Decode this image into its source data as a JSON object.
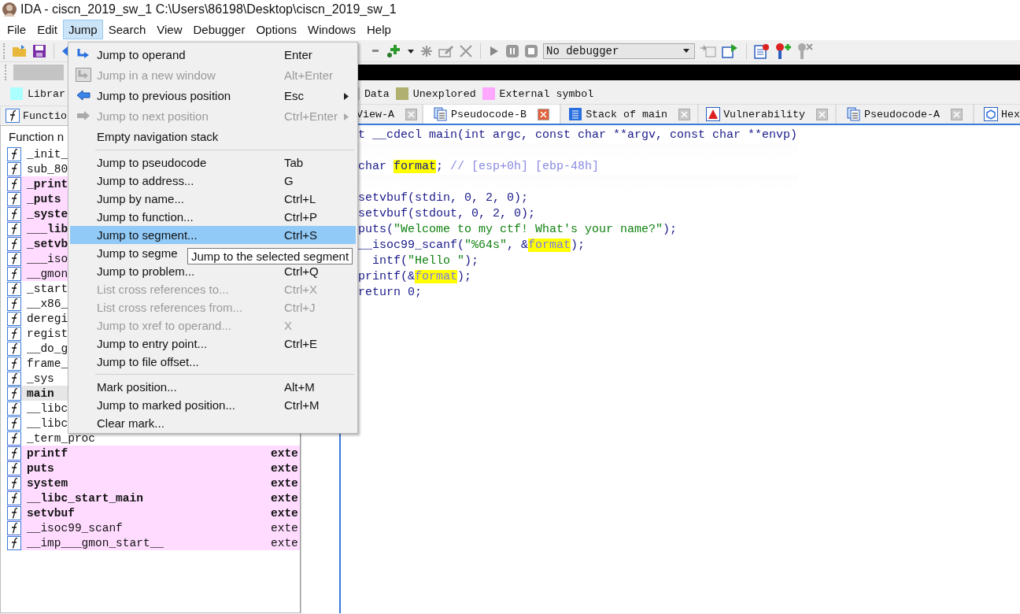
{
  "window": {
    "title": "IDA - ciscn_2019_sw_1 C:\\Users\\86198\\Desktop\\ciscn_2019_sw_1"
  },
  "menubar": [
    {
      "label": "File",
      "selected": false
    },
    {
      "label": "Edit",
      "selected": false
    },
    {
      "label": "Jump",
      "selected": true
    },
    {
      "label": "Search",
      "selected": false
    },
    {
      "label": "View",
      "selected": false
    },
    {
      "label": "Debugger",
      "selected": false
    },
    {
      "label": "Options",
      "selected": false
    },
    {
      "label": "Windows",
      "selected": false
    },
    {
      "label": "Help",
      "selected": false
    }
  ],
  "toolbar": {
    "debugger_select": "No debugger"
  },
  "legend": [
    {
      "label": "Librar",
      "color": "#aaffff"
    },
    {
      "label": "Data",
      "color": "#c0c0c0"
    },
    {
      "label": "Unexplored",
      "color": "#b0b070"
    },
    {
      "label": "External symbol",
      "color": "#ffa8ff"
    }
  ],
  "left_tab": {
    "label": "Functio"
  },
  "functions": {
    "header": "Function n",
    "rows": [
      {
        "name": "_init_",
        "kind": "regular",
        "bold": false,
        "selected": false
      },
      {
        "name": "sub_80",
        "kind": "regular",
        "bold": false,
        "selected": false
      },
      {
        "name": "_print",
        "kind": "extern",
        "bold": true,
        "selected": false
      },
      {
        "name": "_puts",
        "kind": "extern",
        "bold": true,
        "selected": false
      },
      {
        "name": "_syste",
        "kind": "extern",
        "bold": true,
        "selected": false
      },
      {
        "name": "___lib",
        "kind": "extern",
        "bold": true,
        "selected": false
      },
      {
        "name": "_setvb",
        "kind": "extern",
        "bold": true,
        "selected": false
      },
      {
        "name": "___iso",
        "kind": "extern",
        "bold": false,
        "selected": false
      },
      {
        "name": "__gmon",
        "kind": "extern",
        "bold": false,
        "selected": false
      },
      {
        "name": "_start",
        "kind": "regular",
        "bold": false,
        "selected": false
      },
      {
        "name": "__x86_",
        "kind": "regular",
        "bold": false,
        "selected": false
      },
      {
        "name": "deregi",
        "kind": "regular",
        "bold": false,
        "selected": false
      },
      {
        "name": "regist",
        "kind": "regular",
        "bold": false,
        "selected": false
      },
      {
        "name": "__do_g",
        "kind": "regular",
        "bold": false,
        "selected": false
      },
      {
        "name": "frame_",
        "kind": "regular",
        "bold": false,
        "selected": false
      },
      {
        "name": "_sys",
        "kind": "regular",
        "bold": false,
        "selected": false
      },
      {
        "name": "main",
        "kind": "regular",
        "bold": true,
        "selected": true
      },
      {
        "name": "__libc",
        "kind": "regular",
        "bold": false,
        "selected": false
      },
      {
        "name": "__libc",
        "kind": "regular",
        "bold": false,
        "selected": false
      },
      {
        "name": "_term_proc",
        "kind": "regular",
        "bold": false,
        "selected": false
      },
      {
        "name": "printf",
        "segment": "exte",
        "kind": "extern",
        "bold": true,
        "selected": false
      },
      {
        "name": "puts",
        "segment": "exte",
        "kind": "extern",
        "bold": true,
        "selected": false
      },
      {
        "name": "system",
        "segment": "exte",
        "kind": "extern",
        "bold": true,
        "selected": false
      },
      {
        "name": "__libc_start_main",
        "segment": "exte",
        "kind": "extern",
        "bold": true,
        "selected": false
      },
      {
        "name": "setvbuf",
        "segment": "exte",
        "kind": "extern",
        "bold": true,
        "selected": false
      },
      {
        "name": "__isoc99_scanf",
        "segment": "exte",
        "kind": "extern",
        "bold": false,
        "selected": false
      },
      {
        "name": "__imp___gmon_start__",
        "segment": "exte",
        "kind": "extern",
        "bold": false,
        "selected": false
      }
    ]
  },
  "tabs": [
    {
      "label": "View-A",
      "kind": "disassembly",
      "selected": false
    },
    {
      "label": "Pseudocode-B",
      "kind": "pseudocode",
      "selected": true
    },
    {
      "label": "Stack of main",
      "kind": "stack",
      "selected": false
    },
    {
      "label": "Vulnerability",
      "kind": "vulnerability",
      "selected": false
    },
    {
      "label": "Pseudocode-A",
      "kind": "pseudocode",
      "selected": false
    },
    {
      "label": "Hex",
      "kind": "hex",
      "selected": false
    }
  ],
  "code": [
    {
      "spaced": false,
      "hidden_start": false,
      "tokens": [
        {
          "text": "t __cdecl main(int argc, const char **argv, const char **envp)",
          "kind": "code"
        }
      ]
    },
    {
      "spaced": true,
      "hidden_start": false,
      "tokens": [
        {
          "text": "char ",
          "kind": "code"
        },
        {
          "text": "format",
          "kind": "highlight"
        },
        {
          "text": "; ",
          "kind": "code"
        },
        {
          "text": "// [esp+0h] [ebp-48h]",
          "kind": "comment"
        }
      ]
    },
    {
      "spaced": true,
      "hidden_start": false,
      "tokens": [
        {
          "text": "setvbuf(stdin, 0, 2, 0);",
          "kind": "code"
        }
      ]
    },
    {
      "spaced": false,
      "hidden_start": false,
      "tokens": [
        {
          "text": "setvbuf(stdout, 0, 2, 0);",
          "kind": "code"
        }
      ]
    },
    {
      "spaced": false,
      "hidden_start": false,
      "tokens": [
        {
          "text": "puts(",
          "kind": "code"
        },
        {
          "text": "\"Welcome to my ctf! What's your name?\"",
          "kind": "string"
        },
        {
          "text": ");",
          "kind": "code"
        }
      ]
    },
    {
      "spaced": false,
      "hidden_start": false,
      "tokens": [
        {
          "text": "__isoc99_scanf(",
          "kind": "code"
        },
        {
          "text": "\"%64s\"",
          "kind": "string"
        },
        {
          "text": ", &",
          "kind": "code"
        },
        {
          "text": "format",
          "kind": "highlight_var"
        },
        {
          "text": ");",
          "kind": "code"
        }
      ]
    },
    {
      "spaced": false,
      "hidden_start": true,
      "tokens": [
        {
          "text": "intf(",
          "kind": "code"
        },
        {
          "text": "\"Hello \"",
          "kind": "string"
        },
        {
          "text": ");",
          "kind": "code"
        }
      ]
    },
    {
      "spaced": false,
      "hidden_start": false,
      "tokens": [
        {
          "text": "printf(&",
          "kind": "code"
        },
        {
          "text": "format",
          "kind": "highlight_var"
        },
        {
          "text": ");",
          "kind": "code"
        }
      ]
    },
    {
      "spaced": false,
      "hidden_start": false,
      "tokens": [
        {
          "text": "return 0;",
          "kind": "code"
        }
      ]
    }
  ],
  "menu": [
    {
      "kind": "operand",
      "label": "Jump to operand",
      "shortcut": "Enter",
      "disabled": false,
      "highlighted": false,
      "submenu": false
    },
    {
      "kind": "new_window",
      "label": "Jump in a new window",
      "shortcut": "Alt+Enter",
      "disabled": true,
      "highlighted": false,
      "submenu": false
    },
    {
      "kind": "back",
      "label": "Jump to previous position",
      "shortcut": "Esc",
      "disabled": false,
      "highlighted": false,
      "submenu": true
    },
    {
      "kind": "forward",
      "label": "Jump to next position",
      "shortcut": "Ctrl+Enter",
      "disabled": true,
      "highlighted": false,
      "submenu": true
    },
    {
      "kind": "plain_tall",
      "label": "Empty navigation stack",
      "disabled": false,
      "highlighted": false,
      "submenu": false
    },
    {
      "kind": "separator"
    },
    {
      "kind": "item",
      "label": "Jump to pseudocode",
      "shortcut": "Tab",
      "disabled": false,
      "highlighted": false,
      "submenu": false
    },
    {
      "kind": "item",
      "label": "Jump to address...",
      "shortcut": "G",
      "disabled": false,
      "highlighted": false,
      "submenu": false
    },
    {
      "kind": "item",
      "label": "Jump by name...",
      "shortcut": "Ctrl+L",
      "disabled": false,
      "highlighted": false,
      "submenu": false
    },
    {
      "kind": "item",
      "label": "Jump to function...",
      "shortcut": "Ctrl+P",
      "disabled": false,
      "highlighted": false,
      "submenu": false
    },
    {
      "kind": "item",
      "label": "Jump to segment...",
      "shortcut": "Ctrl+S",
      "disabled": false,
      "highlighted": true,
      "submenu": false
    },
    {
      "kind": "item",
      "label": "Jump to segme",
      "disabled": false,
      "highlighted": false
    },
    {
      "kind": "item",
      "label": "Jump to problem...",
      "shortcut": "Ctrl+Q",
      "disabled": false,
      "highlighted": false,
      "submenu": false
    },
    {
      "kind": "item",
      "label": "List cross references to...",
      "shortcut": "Ctrl+X",
      "disabled": true,
      "highlighted": false,
      "submenu": false
    },
    {
      "kind": "item",
      "label": "List cross references from...",
      "shortcut": "Ctrl+J",
      "disabled": true,
      "highlighted": false,
      "submenu": false
    },
    {
      "kind": "item",
      "label": "Jump to xref to operand...",
      "shortcut": "X",
      "disabled": true,
      "highlighted": false,
      "submenu": false
    },
    {
      "kind": "item",
      "label": "Jump to entry point...",
      "shortcut": "Ctrl+E",
      "disabled": false,
      "highlighted": false,
      "submenu": false
    },
    {
      "kind": "item",
      "label": "Jump to file offset...",
      "disabled": false,
      "highlighted": false,
      "submenu": false
    },
    {
      "kind": "separator"
    },
    {
      "kind": "item",
      "label": "Mark position...",
      "shortcut": "Alt+M",
      "disabled": false,
      "highlighted": false,
      "submenu": false
    },
    {
      "kind": "item",
      "label": "Jump to marked position...",
      "shortcut": "Ctrl+M",
      "disabled": false,
      "highlighted": false,
      "submenu": false
    },
    {
      "kind": "item",
      "label": "Clear mark...",
      "disabled": false,
      "highlighted": false,
      "submenu": false
    }
  ],
  "tooltip": "Jump to the selected segment"
}
